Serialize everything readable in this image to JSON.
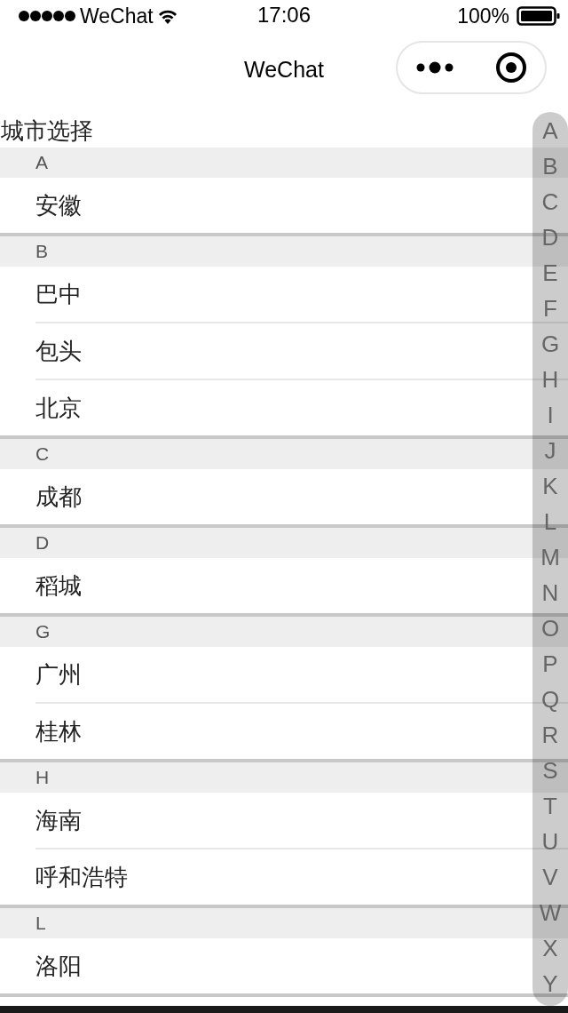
{
  "status_bar": {
    "carrier": "WeChat",
    "time": "17:06",
    "battery": "100%"
  },
  "nav_bar": {
    "title": "WeChat"
  },
  "page_title": "城市选择",
  "sections": [
    {
      "letter": "A",
      "cities": [
        "安徽"
      ]
    },
    {
      "letter": "B",
      "cities": [
        "巴中",
        "包头",
        "北京"
      ]
    },
    {
      "letter": "C",
      "cities": [
        "成都"
      ]
    },
    {
      "letter": "D",
      "cities": [
        "稻城"
      ]
    },
    {
      "letter": "G",
      "cities": [
        "广州",
        "桂林"
      ]
    },
    {
      "letter": "H",
      "cities": [
        "海南",
        "呼和浩特"
      ]
    },
    {
      "letter": "L",
      "cities": [
        "洛阳"
      ]
    }
  ],
  "index_letters": [
    "A",
    "B",
    "C",
    "D",
    "E",
    "F",
    "G",
    "H",
    "I",
    "J",
    "K",
    "L",
    "M",
    "N",
    "O",
    "P",
    "Q",
    "R",
    "S",
    "T",
    "U",
    "V",
    "W",
    "X",
    "Y"
  ]
}
